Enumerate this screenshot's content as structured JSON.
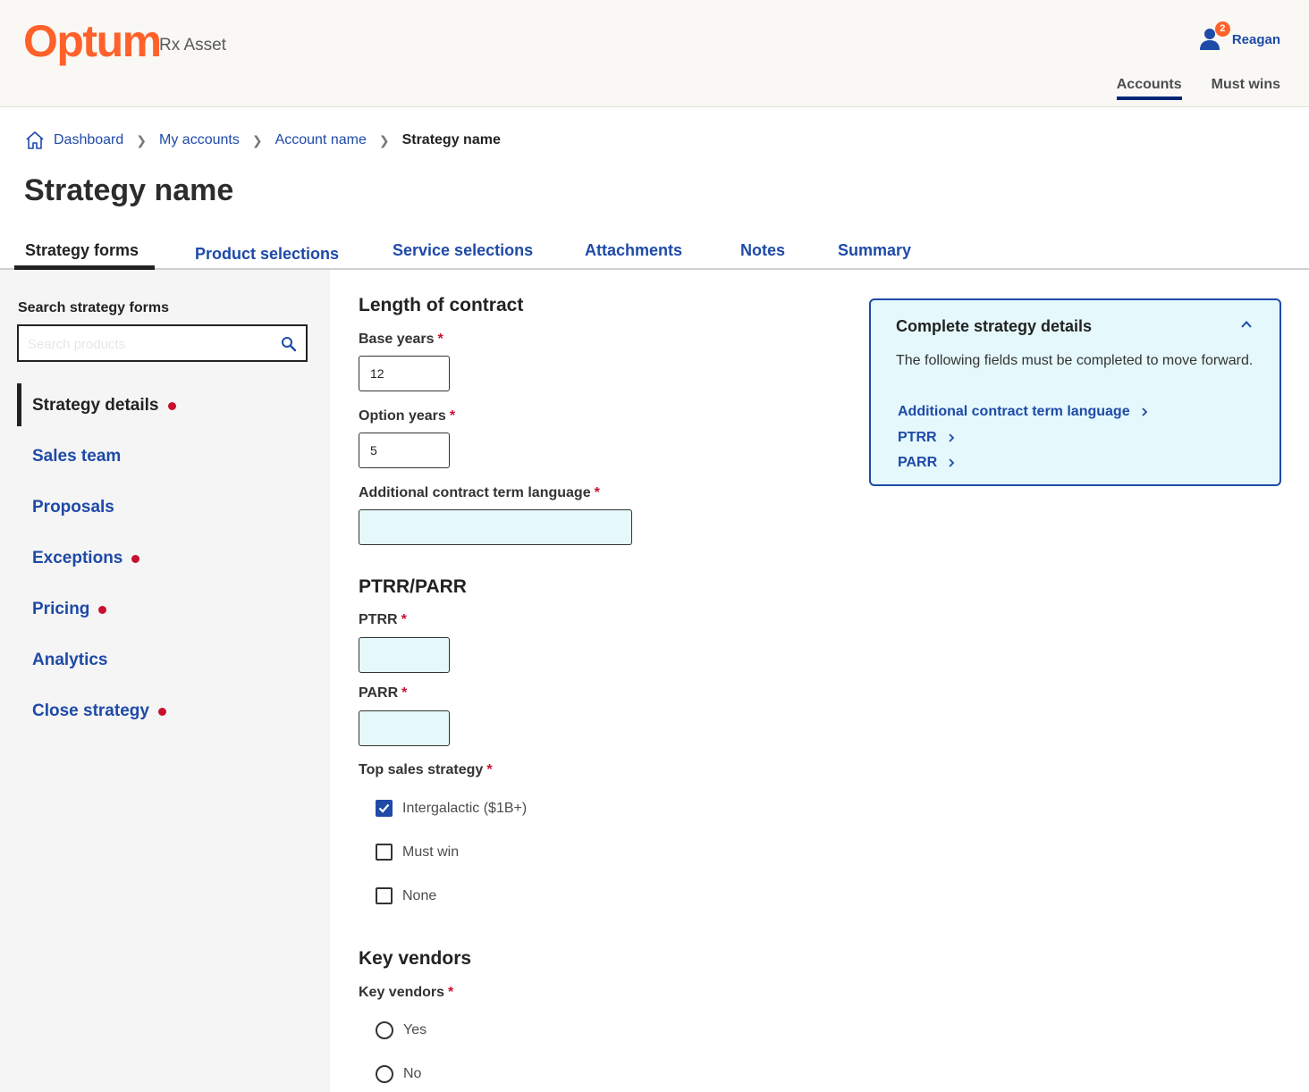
{
  "header": {
    "logo": "Optum",
    "product": "Rx Asset",
    "user": {
      "name": "Reagan",
      "badge_count": "2"
    },
    "nav": [
      {
        "label": "Accounts",
        "active": true
      },
      {
        "label": "Must wins",
        "active": false
      }
    ]
  },
  "breadcrumb": {
    "items": [
      "Dashboard",
      "My accounts",
      "Account name"
    ],
    "current": "Strategy name"
  },
  "page_title": "Strategy name",
  "tabs": [
    "Strategy forms",
    "Product selections",
    "Service selections",
    "Attachments",
    "Notes",
    "Summary"
  ],
  "sidebar": {
    "search_label": "Search strategy forms",
    "search_placeholder": "Search products",
    "items": [
      {
        "label": "Strategy details",
        "active": true,
        "incomplete": true
      },
      {
        "label": "Sales team",
        "active": false,
        "incomplete": false
      },
      {
        "label": "Proposals",
        "active": false,
        "incomplete": false
      },
      {
        "label": "Exceptions",
        "active": false,
        "incomplete": true
      },
      {
        "label": "Pricing",
        "active": false,
        "incomplete": true
      },
      {
        "label": "Analytics",
        "active": false,
        "incomplete": false
      },
      {
        "label": "Close strategy",
        "active": false,
        "incomplete": true
      }
    ]
  },
  "form": {
    "contract": {
      "heading": "Length of contract",
      "base_years_label": "Base years",
      "base_years_value": "12",
      "option_years_label": "Option years",
      "option_years_value": "5",
      "additional_label": "Additional contract term language",
      "additional_value": ""
    },
    "ptrr_parr": {
      "heading": "PTRR/PARR",
      "ptrr_label": "PTRR",
      "ptrr_value": "",
      "parr_label": "PARR",
      "parr_value": ""
    },
    "top_sales": {
      "label": "Top sales strategy",
      "options": [
        {
          "label": "Intergalactic ($1B+)",
          "checked": true
        },
        {
          "label": "Must win",
          "checked": false
        },
        {
          "label": "None",
          "checked": false
        }
      ]
    },
    "key_vendors": {
      "heading": "Key vendors",
      "label": "Key vendors",
      "options": [
        {
          "label": "Yes",
          "selected": false
        },
        {
          "label": "No",
          "selected": false
        }
      ]
    },
    "required_marker": "*"
  },
  "panel": {
    "title": "Complete strategy details",
    "description": "The following fields must be completed to move forward.",
    "links": [
      "Additional contract term language",
      "PTRR",
      "PARR"
    ]
  },
  "colors": {
    "brand": "#ff612b",
    "link": "#1e4aa8",
    "error_dot": "#c8102e",
    "panel_bg": "#e5f8fb"
  }
}
